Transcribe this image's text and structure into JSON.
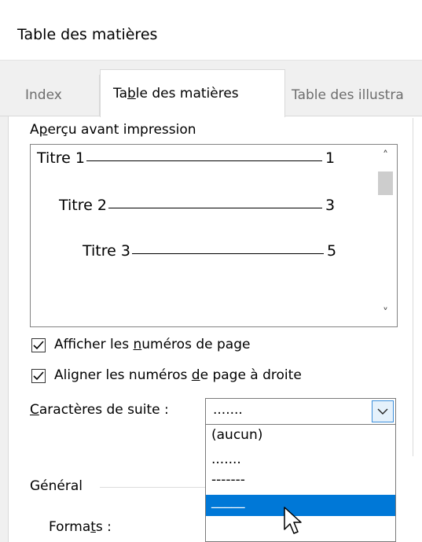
{
  "dialog": {
    "title": "Table des matières"
  },
  "tabs": [
    {
      "label": "Index"
    },
    {
      "label": "Table des matières"
    },
    {
      "label": "Table des illustra"
    }
  ],
  "preview": {
    "label": "Aperçu avant impression",
    "entries": [
      {
        "text": "Titre 1",
        "page": "1"
      },
      {
        "text": "Titre 2",
        "page": "3"
      },
      {
        "text": "Titre 3",
        "page": "5"
      }
    ]
  },
  "options": {
    "show_page_numbers": {
      "label": "Afficher les numéros de page",
      "checked": true
    },
    "align_right": {
      "label": "Aligner les numéros de page à droite",
      "checked": true
    }
  },
  "leader": {
    "label": "Caractères de suite :",
    "selected": ".......",
    "options": [
      "(aucun)",
      ".......",
      "-------",
      "_____"
    ],
    "highlighted_index": 3
  },
  "general": {
    "group_label": "Général",
    "formats_label": "Formats :"
  }
}
